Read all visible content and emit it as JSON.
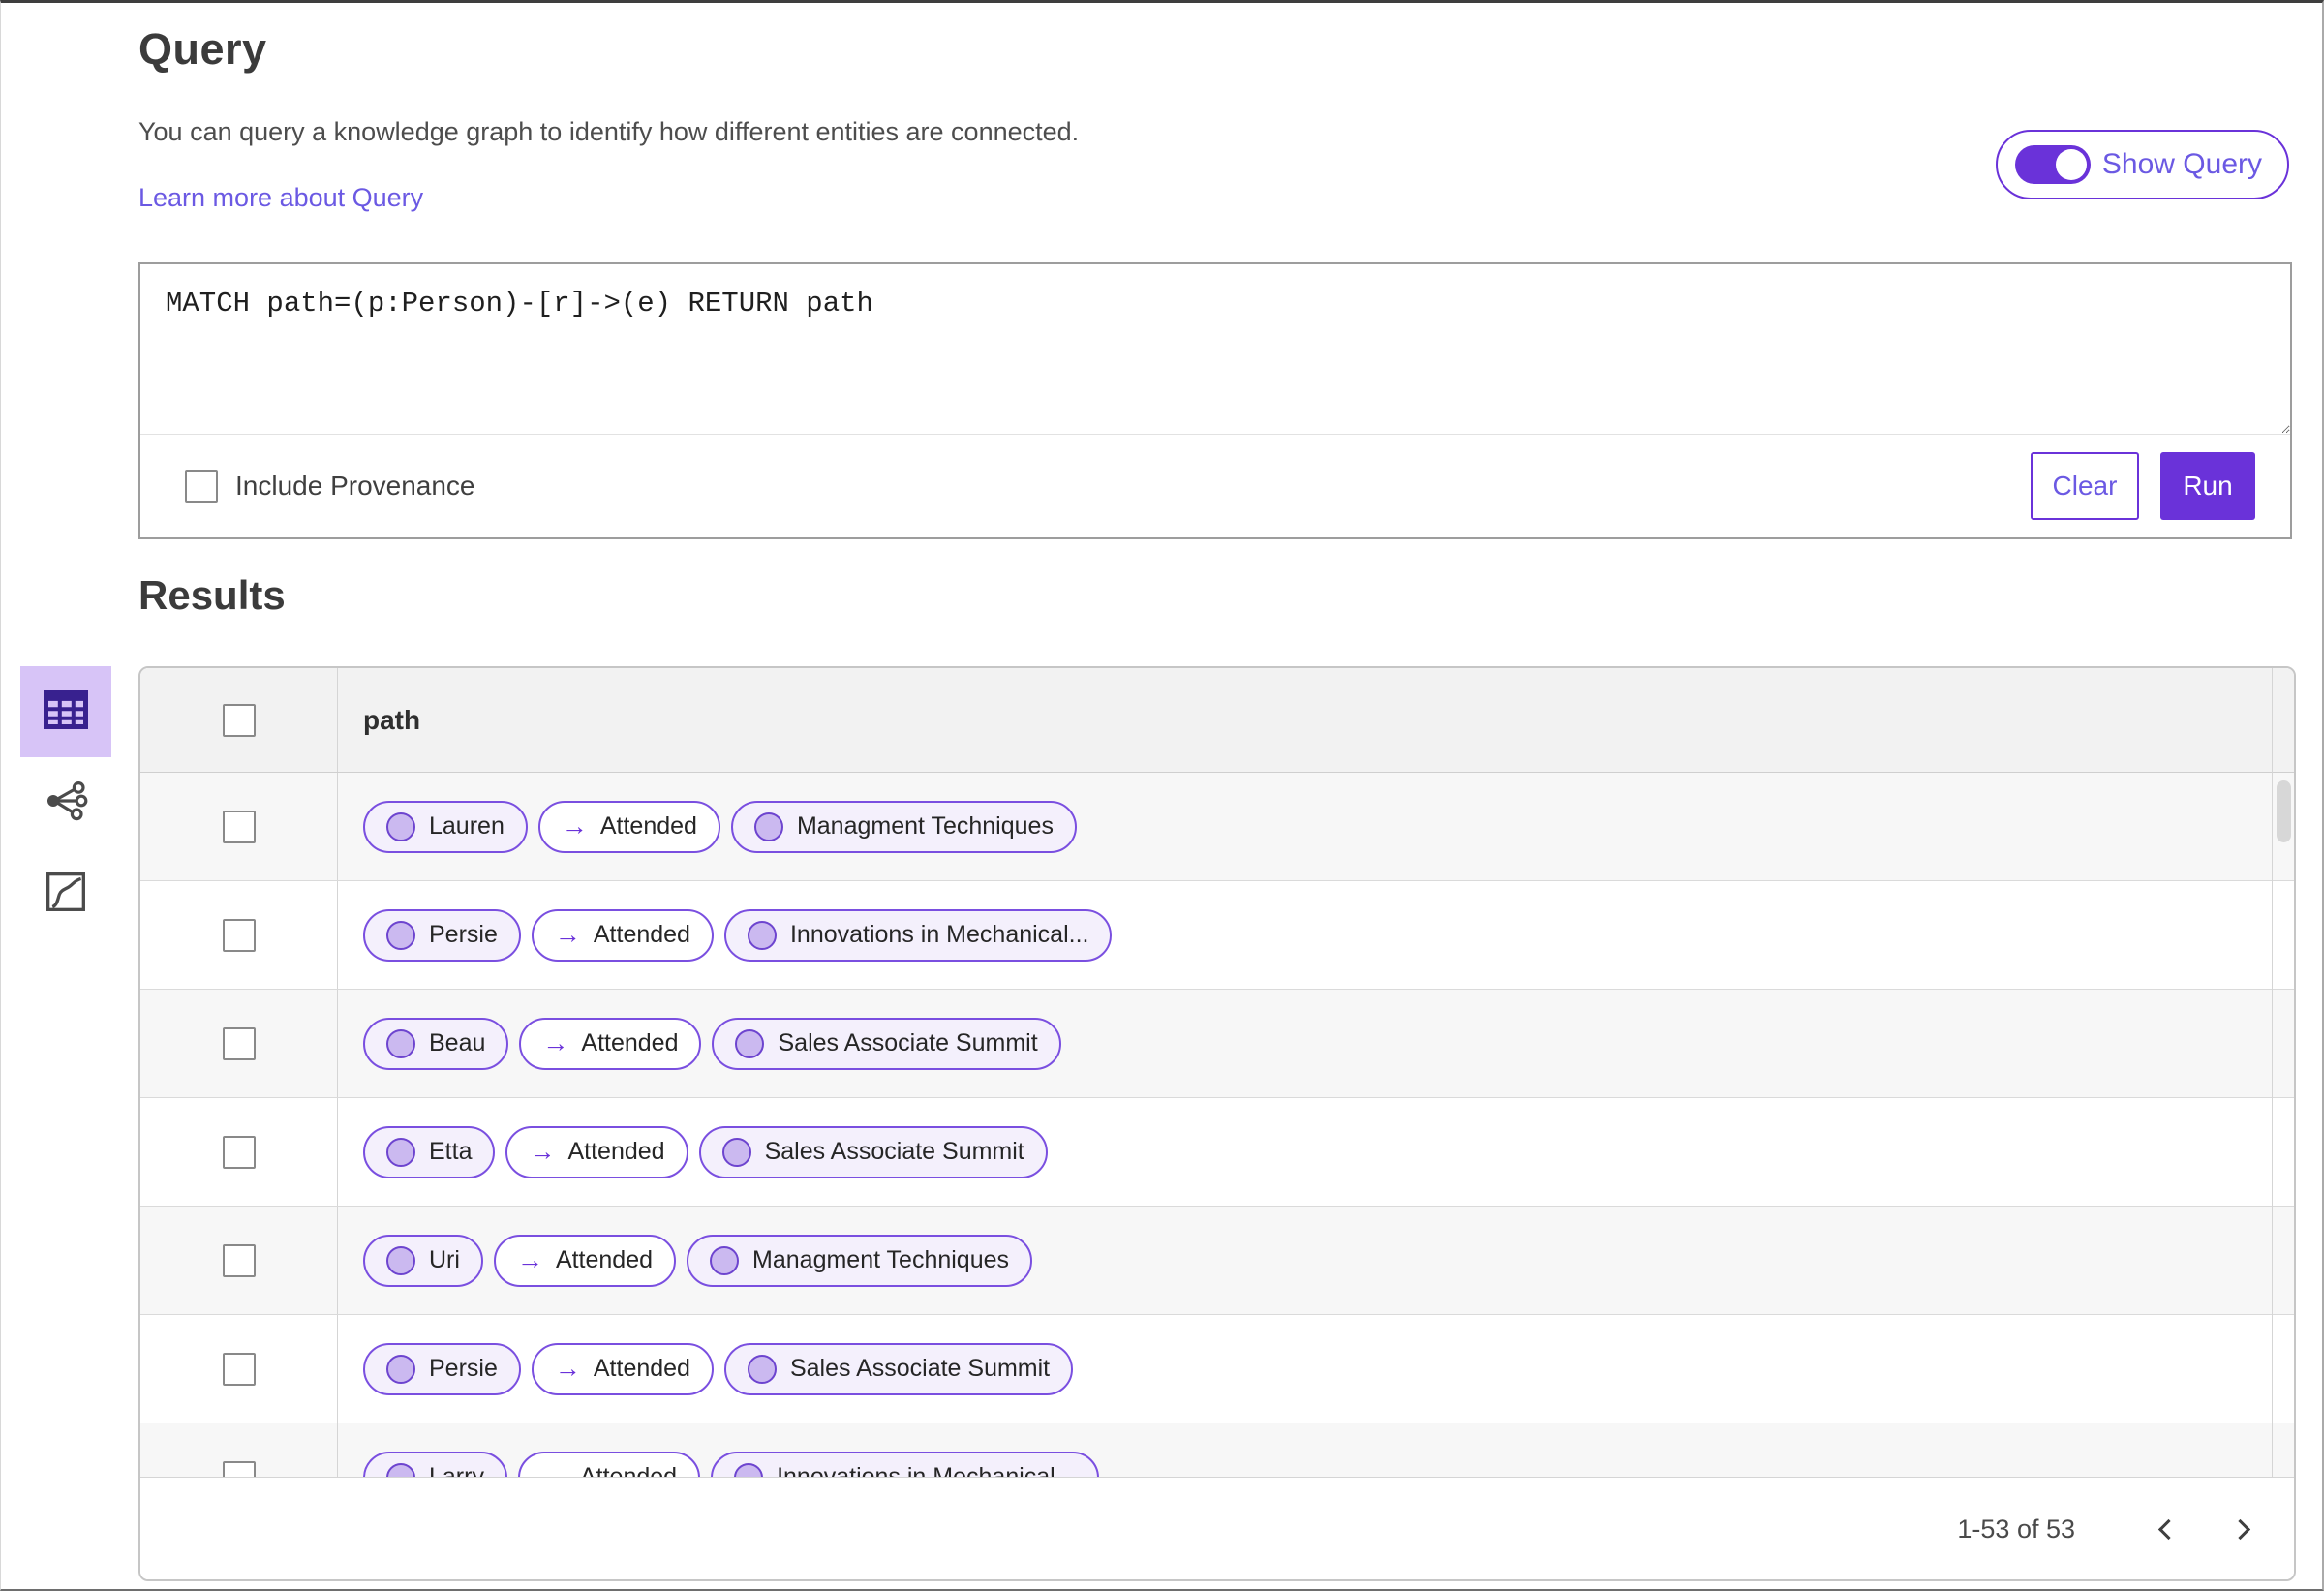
{
  "colors": {
    "accent_purple": "#6a32d9",
    "link_purple": "#6b59e3",
    "chip_border": "#7a4fe0",
    "chip_entity_bg": "#f4f0fc",
    "node_fill": "#cbb9f0",
    "node_ring": "#6d44cf",
    "selected_view_bg": "#d7c4f7",
    "table_icon_indigo": "#38218f",
    "header_row_bg": "#f2f2f2",
    "alt_row_bg": "#f7f7f7"
  },
  "query_section": {
    "title": "Query",
    "description": "You can query a knowledge graph to identify how different entities are connected.",
    "learn_more_link": "Learn more about Query",
    "show_query_toggle": {
      "label": "Show Query",
      "state": "on"
    },
    "editor": {
      "query_text": "MATCH path=(p:Person)-[r]->(e) RETURN path"
    },
    "include_provenance": {
      "label": "Include Provenance",
      "checked": false
    },
    "buttons": {
      "clear": "Clear",
      "run": "Run"
    }
  },
  "results_section": {
    "title": "Results",
    "view_switcher": [
      {
        "id": "table-view",
        "icon": "table-icon",
        "selected": true
      },
      {
        "id": "network-view",
        "icon": "network-icon",
        "selected": false
      },
      {
        "id": "chart-view",
        "icon": "chart-icon",
        "selected": false
      }
    ],
    "table": {
      "column_header": "path",
      "arrow_glyph": "→",
      "rows": [
        {
          "subject": "Lauren",
          "relation": "Attended",
          "object": "Managment Techniques"
        },
        {
          "subject": "Persie",
          "relation": "Attended",
          "object": "Innovations in Mechanical..."
        },
        {
          "subject": "Beau",
          "relation": "Attended",
          "object": "Sales Associate Summit"
        },
        {
          "subject": "Etta",
          "relation": "Attended",
          "object": "Sales Associate Summit"
        },
        {
          "subject": "Uri",
          "relation": "Attended",
          "object": "Managment Techniques"
        },
        {
          "subject": "Persie",
          "relation": "Attended",
          "object": "Sales Associate Summit"
        },
        {
          "subject": "Larry",
          "relation": "Attended",
          "object": "Innovations in Mechanical..."
        }
      ]
    },
    "pagination": {
      "range_label": "1-53 of 53",
      "prev_icon": "chevron-left-icon",
      "next_icon": "chevron-right-icon"
    }
  }
}
